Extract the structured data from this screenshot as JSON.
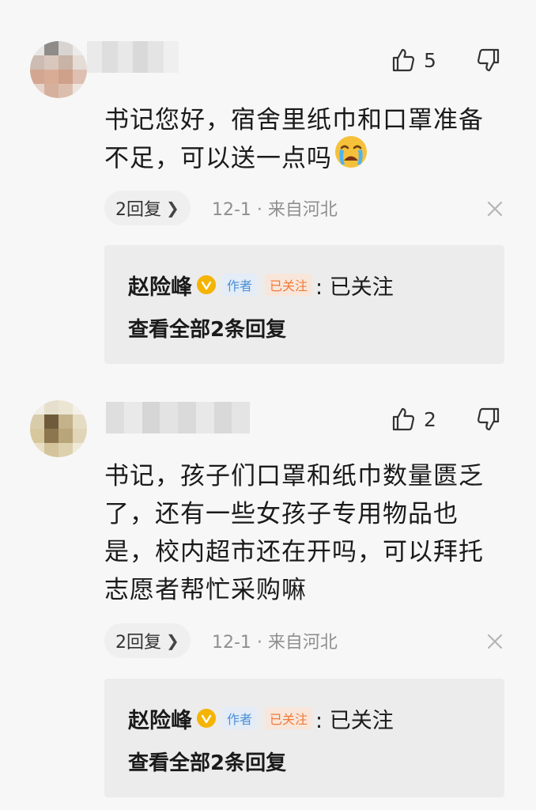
{
  "colors": {
    "background": "#f7f7f7",
    "reply_box": "#ececec",
    "verified_badge": "#f4b400",
    "author_tag_text": "#4a8fd6",
    "follow_tag_text": "#f07a3a"
  },
  "comments": [
    {
      "likes": "5",
      "text_line1": "书记您好，宿舍里纸巾和口罩准备",
      "text_line2": "不足，可以送一点吗",
      "emoji": "crying-face-icon",
      "reply_count_label": "2回复",
      "meta": "12-1 · 来自河北",
      "reply": {
        "author": "赵险峰",
        "author_tag": "作者",
        "follow_tag": "已关注",
        "text": ": 已关注",
        "view_all": "查看全部2条回复"
      }
    },
    {
      "likes": "2",
      "text_lines": [
        "书记，孩子们口罩和纸巾数量匮乏",
        "了，还有一些女孩子专用物品也",
        "是，校内超市还在开吗，可以拜托",
        "志愿者帮忙采购嘛"
      ],
      "reply_count_label": "2回复",
      "meta": "12-1 · 来自河北",
      "reply": {
        "author": "赵险峰",
        "author_tag": "作者",
        "follow_tag": "已关注",
        "text": ": 已关注",
        "view_all": "查看全部2条回复"
      }
    }
  ]
}
